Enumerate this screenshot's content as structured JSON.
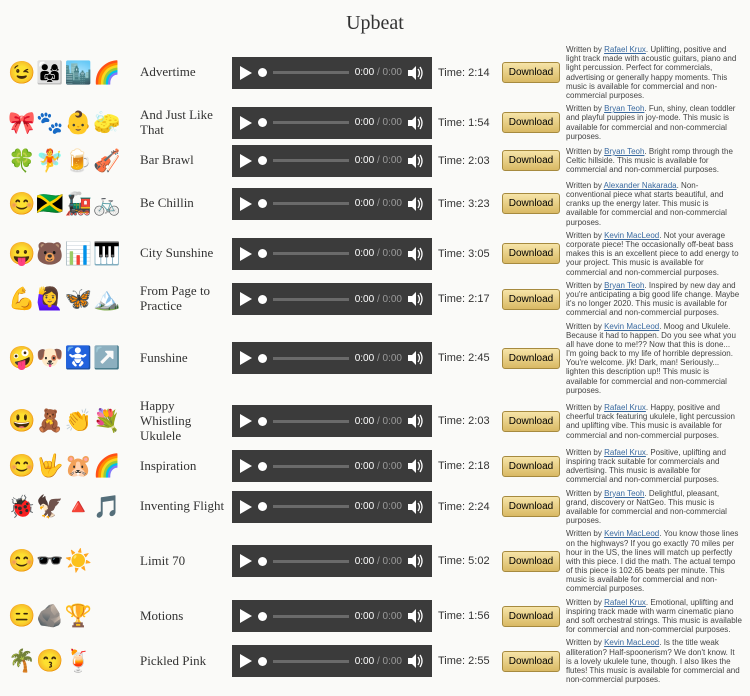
{
  "page_title": "Upbeat",
  "player": {
    "time_current": "0:00",
    "time_total": "0:00"
  },
  "labels": {
    "time_prefix": "Time: ",
    "written_by": "Written by ",
    "download": "Download"
  },
  "tracks": [
    {
      "emojis": "😉👨‍👩‍👧🏙️🌈",
      "title": "Advertime",
      "duration": "2:14",
      "author": "Rafael Krux",
      "blurb": "Uplifting, positive and light track made with acoustic guitars, piano and light percussion. Perfect for commercials, advertising or generally happy moments. This music is available for commercial and non-commercial purposes."
    },
    {
      "emojis": "🎀🐾👶🧽",
      "title": "And Just Like That",
      "duration": "1:54",
      "author": "Bryan Teoh",
      "blurb": "Fun, shiny, clean toddler and playful puppies in joy-mode. This music is available for commercial and non-commercial purposes."
    },
    {
      "emojis": "🍀🧚🍺🎻",
      "title": "Bar Brawl",
      "duration": "2:03",
      "author": "Bryan Teoh",
      "blurb": "Bright romp through the Celtic hillside. This music is available for commercial and non-commercial purposes."
    },
    {
      "emojis": "😊🇯🇲🚂🚲",
      "title": "Be Chillin",
      "duration": "3:23",
      "author": "Alexander Nakarada",
      "blurb": "Non-conventional piece what starts beautiful, and cranks up the energy later. This music is available for commercial and non-commercial purposes."
    },
    {
      "emojis": "😛🐻📊🎹",
      "title": "City Sunshine",
      "duration": "3:05",
      "author": "Kevin MacLeod",
      "blurb": "Not your average corporate piece! The occasionally off-beat bass makes this is an excellent piece to add energy to your project. This music is available for commercial and non-commercial purposes."
    },
    {
      "emojis": "💪🙋‍♀️🦋🏔️",
      "title": "From Page to Practice",
      "duration": "2:17",
      "author": "Bryan Teoh",
      "blurb": "Inspired by new day and you're anticipating a big good life change. Maybe it's no longer 2020. This music is available for commercial and non-commercial purposes."
    },
    {
      "emojis": "🤪🐶🚼↗️",
      "title": "Funshine",
      "duration": "2:45",
      "author": "Kevin MacLeod",
      "blurb": "Moog and Ukulele. Because it had to happen. Do you see what you all have done to me!?? Now that this is done... I'm going back to my life of horrible depression. You're welcome. j/k! Dark, man! Seriously... lighten this description up!! This music is available for commercial and non-commercial purposes."
    },
    {
      "emojis": "😃🧸👏💐",
      "title": "Happy Whistling Ukulele",
      "duration": "2:03",
      "author": "Rafael Krux",
      "blurb": "Happy, positive and cheerful track featuring ukulele, light percussion and uplifting vibe. This music is available for commercial and non-commercial purposes."
    },
    {
      "emojis": "😊🤟🐹🌈",
      "title": "Inspiration",
      "duration": "2:18",
      "author": "Rafael Krux",
      "blurb": "Positive, uplifting and inspiring track suitable for commercials and advertising. This music is available for commercial and non-commercial purposes."
    },
    {
      "emojis": "🐞🦅🔺🎵",
      "title": "Inventing Flight",
      "duration": "2:24",
      "author": "Bryan Teoh",
      "blurb": "Delightful, pleasant, grand, discovery or NatGeo. This music is available for commercial and non-commercial purposes."
    },
    {
      "emojis": "😊🕶️☀️",
      "title": "Limit 70",
      "duration": "5:02",
      "author": "Kevin MacLeod",
      "blurb": "You know those lines on the highways? If you go exactly 70 miles per hour in the US, the lines will match up perfectly with this piece. I did the math. The actual tempo of this piece is 102.65 beats per minute. This music is available for commercial and non-commercial purposes."
    },
    {
      "emojis": "😑🪨🏆",
      "title": "Motions",
      "duration": "1:56",
      "author": "Rafael Krux",
      "blurb": "Emotional, uplifting and inspiring track made with warm cinematic piano and soft orchestral strings. This music is available for commercial and non-commercial purposes."
    },
    {
      "emojis": "🌴😙🍹",
      "title": "Pickled Pink",
      "duration": "2:55",
      "author": "Kevin MacLeod",
      "blurb": "Is the title weak alliteration? Half-spoonerism? We don't know. It is a lovely ukulele tune, though. I also likes the flutes! This music is available for commercial and non-commercial purposes."
    }
  ]
}
